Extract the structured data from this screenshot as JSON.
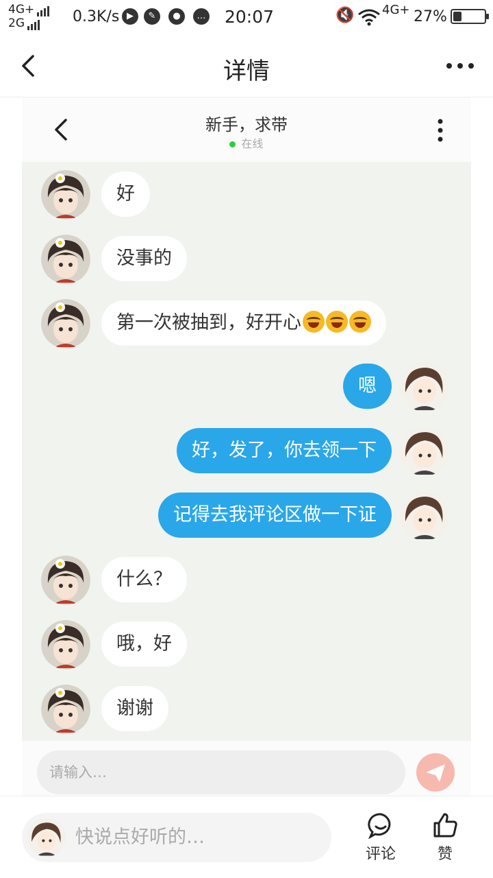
{
  "status_bar": {
    "network_1": "4G+",
    "network_2": "2G",
    "speed": "0.3K/s",
    "time": "20:07",
    "network_right": "4G+",
    "battery": "27%",
    "battery_level": 0.27
  },
  "app_header": {
    "title": "详情"
  },
  "chat": {
    "contact_name": "新手，求带",
    "status": "在线",
    "messages": [
      {
        "side": "in",
        "text": "好"
      },
      {
        "side": "in",
        "text": "没事的"
      },
      {
        "side": "in",
        "text": "第一次被抽到，好开心",
        "emojis": 3
      },
      {
        "side": "out",
        "text": "嗯"
      },
      {
        "side": "out",
        "text": "好，发了，你去领一下"
      },
      {
        "side": "out",
        "text": "记得去我评论区做一下证"
      },
      {
        "side": "in",
        "text": "什么？"
      },
      {
        "side": "in",
        "text": "哦，好"
      },
      {
        "side": "in",
        "text": "谢谢"
      }
    ],
    "input_placeholder": "请输入…"
  },
  "bottom_bar": {
    "comment_placeholder": "快说点好听的…",
    "comment_label": "评论",
    "like_label": "赞"
  },
  "colors": {
    "accent": "#2aa7e9",
    "chat_bg": "#f1f3ef",
    "online": "#2ecc40"
  }
}
